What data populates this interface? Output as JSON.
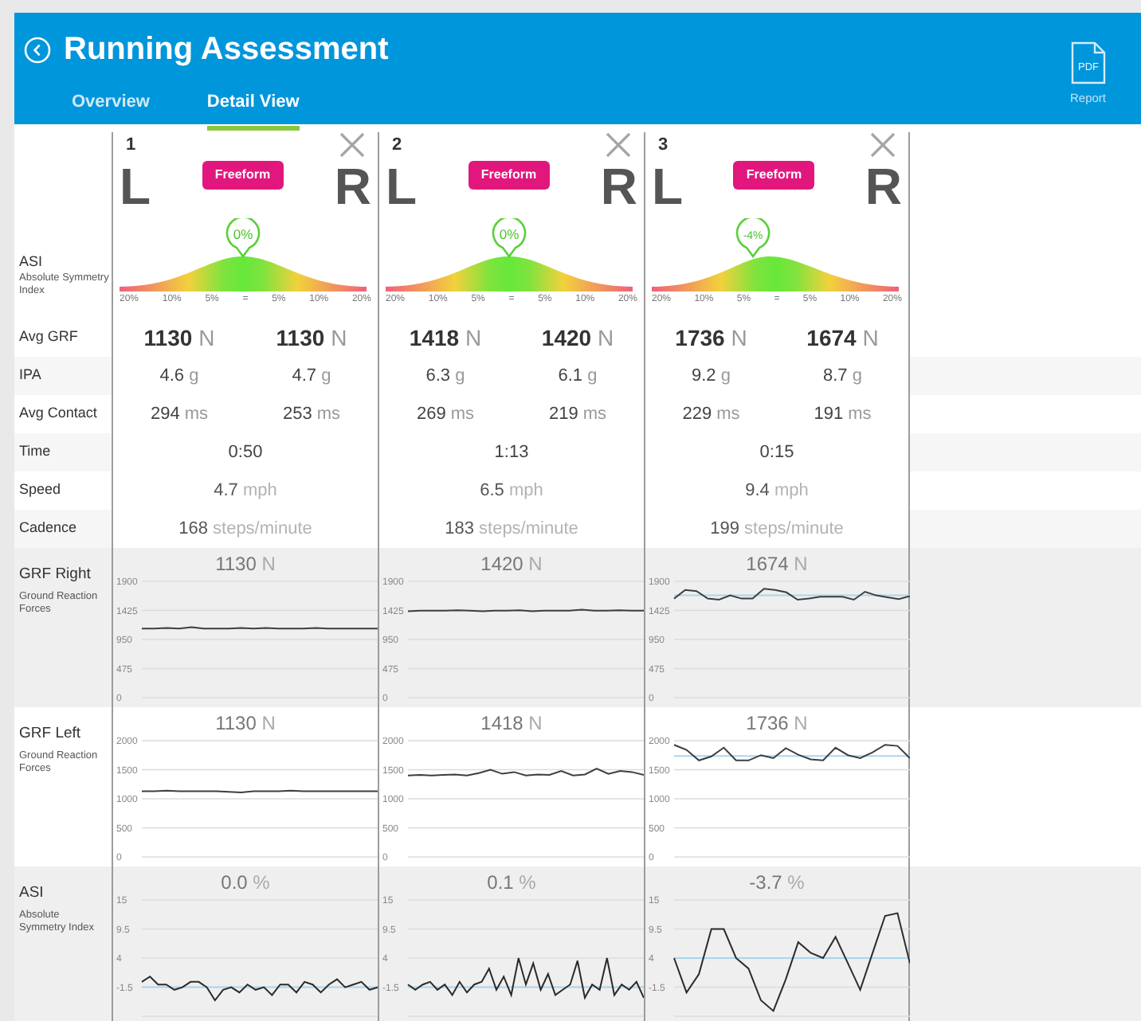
{
  "header": {
    "title": "Running Assessment",
    "tabs": [
      {
        "label": "Overview",
        "selected": false
      },
      {
        "label": "Detail View",
        "selected": true
      }
    ],
    "pdf_label": "PDF",
    "report_label": "Report"
  },
  "metric_labels": [
    {
      "kind": "gauge",
      "title": "ASI",
      "subtitle": "Absolute Symmetry Index"
    },
    {
      "kind": "stat",
      "title": "Avg GRF"
    },
    {
      "kind": "stat",
      "title": "IPA"
    },
    {
      "kind": "stat",
      "title": "Avg Contact"
    },
    {
      "kind": "stat",
      "title": "Time"
    },
    {
      "kind": "stat",
      "title": "Speed"
    },
    {
      "kind": "stat",
      "title": "Cadence"
    }
  ],
  "sessions": [
    {
      "number": "1",
      "left": "L",
      "right": "R",
      "badge": "Freeform",
      "asi": {
        "label": "0%",
        "level": 0.5,
        "ticks": [
          "20%",
          "10%",
          "5%",
          "=",
          "5%",
          "10%",
          "20%"
        ]
      },
      "avg_grf": [
        {
          "value": "1130",
          "unit": "N"
        },
        {
          "value": "1130",
          "unit": "N"
        }
      ],
      "ipa": [
        {
          "value": "4.6",
          "unit": "g"
        },
        {
          "value": "4.7",
          "unit": "g"
        }
      ],
      "contact": [
        {
          "value": "294",
          "unit": "ms"
        },
        {
          "value": "253",
          "unit": "ms"
        }
      ],
      "time": "0:50",
      "speed": {
        "value": "4.7",
        "unit": "mph"
      },
      "cadence": {
        "value": "168",
        "unit": "steps/minute"
      }
    },
    {
      "number": "2",
      "left": "L",
      "right": "R",
      "badge": "Freeform",
      "asi": {
        "label": "0%",
        "level": 0.5,
        "ticks": [
          "20%",
          "10%",
          "5%",
          "=",
          "5%",
          "10%",
          "20%"
        ]
      },
      "avg_grf": [
        {
          "value": "1418",
          "unit": "N"
        },
        {
          "value": "1420",
          "unit": "N"
        }
      ],
      "ipa": [
        {
          "value": "6.3",
          "unit": "g"
        },
        {
          "value": "6.1",
          "unit": "g"
        }
      ],
      "contact": [
        {
          "value": "269",
          "unit": "ms"
        },
        {
          "value": "219",
          "unit": "ms"
        }
      ],
      "time": "1:13",
      "speed": {
        "value": "6.5",
        "unit": "mph"
      },
      "cadence": {
        "value": "183",
        "unit": "steps/minute"
      }
    },
    {
      "number": "3",
      "left": "L",
      "right": "R",
      "badge": "Freeform",
      "asi": {
        "label": "-4%",
        "level": 0.41,
        "ticks": [
          "20%",
          "10%",
          "5%",
          "=",
          "5%",
          "10%",
          "20%"
        ]
      },
      "avg_grf": [
        {
          "value": "1736",
          "unit": "N"
        },
        {
          "value": "1674",
          "unit": "N"
        }
      ],
      "ipa": [
        {
          "value": "9.2",
          "unit": "g"
        },
        {
          "value": "8.7",
          "unit": "g"
        }
      ],
      "contact": [
        {
          "value": "229",
          "unit": "ms"
        },
        {
          "value": "191",
          "unit": "ms"
        }
      ],
      "time": "0:15",
      "speed": {
        "value": "9.4",
        "unit": "mph"
      },
      "cadence": {
        "value": "199",
        "unit": "steps/minute"
      }
    }
  ],
  "chart_rows": [
    {
      "title": "GRF Right",
      "subtitle": "Ground Reaction Forces",
      "charts": [
        {
          "value": "1130",
          "unit": "N",
          "chart_data": {
            "type": "line",
            "grid": true,
            "ylim": [
              0,
              1900
            ],
            "yticks": [
              0,
              475,
              950,
              1425,
              1900
            ],
            "series": [
              {
                "color": "#3a3f44",
                "values": [
                  1130,
                  1130,
                  1140,
                  1130,
                  1150,
                  1130,
                  1130,
                  1130,
                  1140,
                  1130,
                  1140,
                  1130,
                  1130,
                  1130,
                  1140,
                  1130,
                  1130,
                  1130,
                  1130,
                  1130
                ]
              }
            ]
          }
        },
        {
          "value": "1420",
          "unit": "N",
          "chart_data": {
            "type": "line",
            "grid": true,
            "ylim": [
              0,
              1900
            ],
            "yticks": [
              0,
              475,
              950,
              1425,
              1900
            ],
            "series": [
              {
                "color": "#3a3f44",
                "values": [
                  1410,
                  1420,
                  1420,
                  1420,
                  1430,
                  1420,
                  1410,
                  1420,
                  1420,
                  1430,
                  1410,
                  1420,
                  1420,
                  1420,
                  1440,
                  1420,
                  1420,
                  1430,
                  1420,
                  1420
                ]
              }
            ]
          }
        },
        {
          "value": "1674",
          "unit": "N",
          "chart_data": {
            "type": "line",
            "grid": true,
            "ylim": [
              0,
              1900
            ],
            "yticks": [
              0,
              475,
              950,
              1425,
              1900
            ],
            "series": [
              {
                "color": "#a9d6ee",
                "values": [
                  1674,
                  1674,
                  1674,
                  1674,
                  1674,
                  1674,
                  1674,
                  1674,
                  1674,
                  1674,
                  1674,
                  1674,
                  1674,
                  1674,
                  1674,
                  1674,
                  1674,
                  1674,
                  1674,
                  1674,
                  1674,
                  1674
                ]
              },
              {
                "color": "#3a3f44",
                "values": [
                  1620,
                  1760,
                  1740,
                  1620,
                  1600,
                  1670,
                  1620,
                  1620,
                  1780,
                  1760,
                  1720,
                  1600,
                  1620,
                  1650,
                  1650,
                  1650,
                  1600,
                  1730,
                  1670,
                  1640,
                  1610,
                  1660
                ]
              }
            ]
          }
        }
      ]
    },
    {
      "title": "GRF Left",
      "subtitle": "Ground Reaction Forces",
      "charts": [
        {
          "value": "1130",
          "unit": "N",
          "chart_data": {
            "type": "line",
            "grid": true,
            "ylim": [
              0,
              2000
            ],
            "yticks": [
              0,
              500,
              1000,
              1500,
              2000
            ],
            "series": [
              {
                "color": "#3a3f44",
                "values": [
                  1130,
                  1130,
                  1140,
                  1130,
                  1130,
                  1130,
                  1130,
                  1120,
                  1110,
                  1130,
                  1130,
                  1130,
                  1140,
                  1130,
                  1130,
                  1130,
                  1130,
                  1130,
                  1130,
                  1130
                ]
              }
            ]
          }
        },
        {
          "value": "1418",
          "unit": "N",
          "chart_data": {
            "type": "line",
            "grid": true,
            "ylim": [
              0,
              2000
            ],
            "yticks": [
              0,
              500,
              1000,
              1500,
              2000
            ],
            "series": [
              {
                "color": "#3a3f44",
                "values": [
                  1400,
                  1410,
                  1400,
                  1410,
                  1420,
                  1400,
                  1440,
                  1500,
                  1430,
                  1460,
                  1400,
                  1420,
                  1410,
                  1480,
                  1400,
                  1420,
                  1520,
                  1430,
                  1480,
                  1460,
                  1410
                ]
              }
            ]
          }
        },
        {
          "value": "1736",
          "unit": "N",
          "chart_data": {
            "type": "line",
            "grid": true,
            "ylim": [
              0,
              2000
            ],
            "yticks": [
              0,
              500,
              1000,
              1500,
              2000
            ],
            "series": [
              {
                "color": "#a9d6ee",
                "values": [
                  1736,
                  1736,
                  1736,
                  1736,
                  1736,
                  1736,
                  1736,
                  1736,
                  1736,
                  1736,
                  1736,
                  1736,
                  1736,
                  1736,
                  1736,
                  1736,
                  1736,
                  1736,
                  1736,
                  1736
                ]
              },
              {
                "color": "#3a3f44",
                "values": [
                  1930,
                  1840,
                  1660,
                  1730,
                  1880,
                  1660,
                  1660,
                  1750,
                  1700,
                  1870,
                  1760,
                  1680,
                  1660,
                  1880,
                  1750,
                  1700,
                  1800,
                  1930,
                  1910,
                  1700
                ]
              }
            ]
          }
        }
      ]
    },
    {
      "title": "ASI",
      "subtitle": "Absolute Symmetry Index",
      "charts": [
        {
          "value": "0.0",
          "unit": "%",
          "chart_data": {
            "type": "line",
            "grid": true,
            "ylim": [
              -7,
              15
            ],
            "yticks": [
              -1.5,
              4,
              9.5,
              15
            ],
            "series": [
              {
                "color": "#a9d6ee",
                "values": [
                  -1.5,
                  -1.5,
                  -1.5,
                  -1.5,
                  -1.5,
                  -1.5,
                  -1.5,
                  -1.5,
                  -1.5,
                  -1.5,
                  -1.5,
                  -1.5,
                  -1.5,
                  -1.5,
                  -1.5,
                  -1.5,
                  -1.5,
                  -1.5,
                  -1.5,
                  -1.5,
                  -1.5,
                  -1.5,
                  -1.5,
                  -1.5,
                  -1.5,
                  -1.5,
                  -1.5,
                  -1.5,
                  -1.5,
                  -1.5
                ]
              },
              {
                "color": "#2a2a2a",
                "values": [
                  -0.5,
                  0.5,
                  -1,
                  -1,
                  -2,
                  -1.5,
                  -0.5,
                  -0.5,
                  -1.5,
                  -4,
                  -2,
                  -1.5,
                  -2.5,
                  -1,
                  -2,
                  -1.5,
                  -3,
                  -1,
                  -1,
                  -2.5,
                  -0.5,
                  -1,
                  -2.5,
                  -1,
                  0,
                  -1.5,
                  -1,
                  -0.5,
                  -2,
                  -1.5
                ]
              }
            ]
          }
        },
        {
          "value": "0.1",
          "unit": "%",
          "chart_data": {
            "type": "line",
            "grid": true,
            "ylim": [
              -7,
              15
            ],
            "yticks": [
              -1.5,
              4,
              9.5,
              15
            ],
            "series": [
              {
                "color": "#a9d6ee",
                "values": [
                  -1.5,
                  -1.5,
                  -1.5,
                  -1.5,
                  -1.5,
                  -1.5,
                  -1.5,
                  -1.5,
                  -1.5,
                  -1.5,
                  -1.5,
                  -1.5,
                  -1.5,
                  -1.5,
                  -1.5,
                  -1.5,
                  -1.5,
                  -1.5,
                  -1.5,
                  -1.5,
                  -1.5,
                  -1.5,
                  -1.5,
                  -1.5,
                  -1.5,
                  -1.5,
                  -1.5,
                  -1.5,
                  -1.5,
                  -1.5,
                  -1.5,
                  -1.5,
                  -1.5
                ]
              },
              {
                "color": "#2a2a2a",
                "values": [
                  -1,
                  -2,
                  -1,
                  -0.5,
                  -2,
                  -1,
                  -3,
                  -0.5,
                  -2.5,
                  -1,
                  -0.5,
                  2,
                  -2,
                  0.5,
                  -3,
                  4,
                  -1,
                  3,
                  -2,
                  1,
                  -3,
                  -2,
                  -1,
                  3.5,
                  -3.5,
                  -1,
                  -2,
                  4,
                  -3,
                  -1,
                  -2,
                  -0.5,
                  -3.5
                ]
              }
            ]
          }
        },
        {
          "value": "-3.7",
          "unit": "%",
          "chart_data": {
            "type": "line",
            "grid": true,
            "ylim": [
              -7,
              15
            ],
            "yticks": [
              -1.5,
              4,
              9.5,
              15
            ],
            "series": [
              {
                "color": "#a9d6ee",
                "values": [
                  4,
                  4,
                  4,
                  4,
                  4,
                  4,
                  4,
                  4,
                  4,
                  4,
                  4,
                  4,
                  4,
                  4,
                  4,
                  4,
                  4,
                  4,
                  4,
                  4
                ]
              },
              {
                "color": "#2a2a2a",
                "values": [
                  4,
                  -2.5,
                  1,
                  9.5,
                  9.5,
                  4,
                  2,
                  -4,
                  -6,
                  0,
                  7,
                  5,
                  4,
                  8,
                  3,
                  -2,
                  5,
                  12,
                  12.5,
                  3
                ]
              }
            ]
          }
        }
      ]
    }
  ]
}
